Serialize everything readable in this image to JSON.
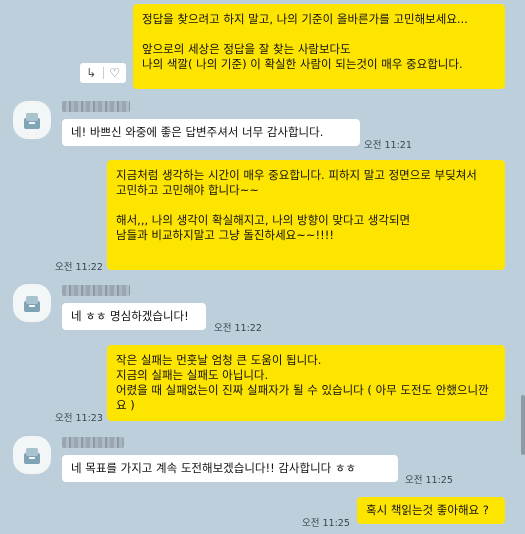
{
  "messages": [
    {
      "side": "me",
      "text": "정답을 찾으려고 하지 말고, 나의 기준이 올바른가를 고민해보세요...\n\n앞으로의 세상은 정답을 잘 찾는 사람보다도\n나의 색깔( 나의 기준) 이 확실한 사람이 되는것이 매우 중요합니다."
    },
    {
      "side": "other",
      "text": "네! 바쁘신 와중에 좋은 답변주셔서 너무 감사합니다.",
      "time": "오전 11:21"
    },
    {
      "side": "me",
      "text": "지금처럼 생각하는 시간이 매우 중요합니다. 피하지 말고 정면으로 부딪쳐서\n고민하고 고민해야 합니다~~\n\n해서,,, 나의 생각이 확실해지고, 나의 방향이 맞다고 생각되면\n남들과 비교하지말고 그냥 돌진하세요~~!!!!",
      "time": "오전 11:22"
    },
    {
      "side": "other",
      "text": "네 ㅎㅎ 명심하겠습니다!",
      "time": "오전 11:22"
    },
    {
      "side": "me",
      "text": "작은 실패는 먼훗날 엄청 큰 도움이 됩니다.\n지금의 실패는 실패도 아닙니다.\n어렸을 때 실패없는이 진짜 실패자가 될 수 있습니다 ( 아무 도전도 안했으니깐요 )",
      "time": "오전 11:23"
    },
    {
      "side": "other",
      "text": "네 목표를 가지고 계속 도전해보겠습니다!! 감사합니다 ㅎㅎ",
      "time": "오전 11:25"
    },
    {
      "side": "me",
      "text": "혹시 책읽는것 좋아해요 ?",
      "time": "오전 11:25"
    }
  ],
  "actions": {
    "reply_glyph": "↳",
    "like_glyph": "♡"
  },
  "icons": {
    "reply": "reply-icon",
    "like": "heart-icon",
    "avatar": "default-profile-avatar"
  },
  "colors": {
    "background": "#bccfdb",
    "my_bubble": "#fee500",
    "their_bubble": "#ffffff"
  }
}
